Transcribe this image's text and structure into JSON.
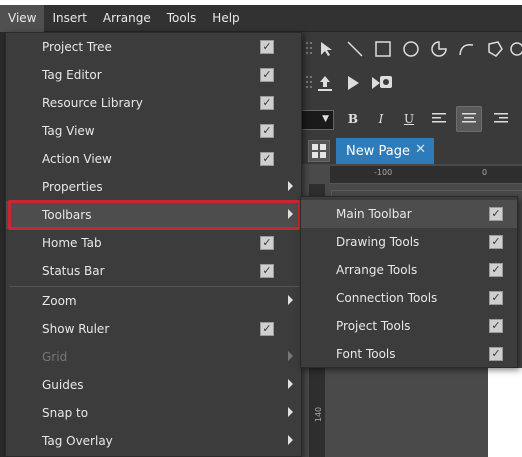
{
  "menubar": {
    "items": [
      "View",
      "Insert",
      "Arrange",
      "Tools",
      "Help"
    ]
  },
  "view_menu": {
    "items": [
      {
        "label": "Project Tree",
        "checked": true
      },
      {
        "label": "Tag Editor",
        "checked": true
      },
      {
        "label": "Resource Library",
        "checked": true
      },
      {
        "label": "Tag View",
        "checked": true
      },
      {
        "label": "Action View",
        "checked": true
      },
      {
        "label": "Properties",
        "submenu": true
      },
      {
        "label": "Toolbars",
        "submenu": true,
        "highlighted": true
      },
      {
        "label": "Home Tab",
        "checked": true
      },
      {
        "label": "Status Bar",
        "checked": true
      },
      {
        "label": "Zoom",
        "submenu": true
      },
      {
        "label": "Show Ruler",
        "checked": true
      },
      {
        "label": "Grid",
        "submenu": true,
        "disabled": true
      },
      {
        "label": "Guides",
        "submenu": true
      },
      {
        "label": "Snap to",
        "submenu": true
      },
      {
        "label": "Tag Overlay",
        "submenu": true
      }
    ]
  },
  "toolbars_submenu": {
    "items": [
      {
        "label": "Main Toolbar",
        "checked": true
      },
      {
        "label": "Drawing Tools",
        "checked": true
      },
      {
        "label": "Arrange Tools",
        "checked": true
      },
      {
        "label": "Connection Tools",
        "checked": true
      },
      {
        "label": "Project Tools",
        "checked": true
      },
      {
        "label": "Font Tools",
        "checked": true
      }
    ]
  },
  "check_glyph": "✓",
  "format_buttons": {
    "bold": "B",
    "italic": "I",
    "underline": "U"
  },
  "tab": {
    "label": "New Page",
    "close": "✕"
  },
  "ruler": {
    "h_labels": [
      "-100",
      "0"
    ],
    "v_label": "140"
  },
  "colors": {
    "accent_tab": "#2d7bb9",
    "highlight_border": "#c8282d"
  }
}
